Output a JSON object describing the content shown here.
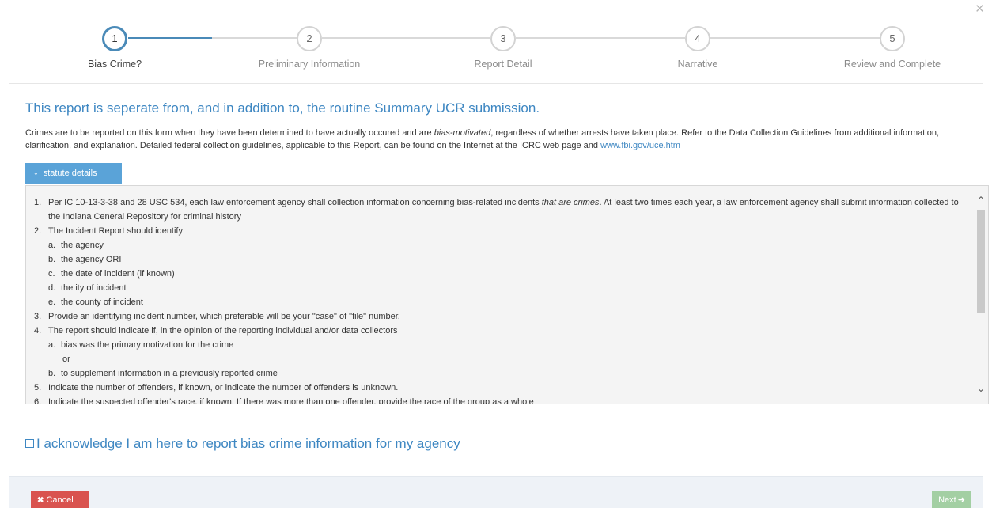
{
  "close_label": "×",
  "steps": [
    {
      "number": "1",
      "label": "Bias Crime?",
      "active": true
    },
    {
      "number": "2",
      "label": "Preliminary Information",
      "active": false
    },
    {
      "number": "3",
      "label": "Report Detail",
      "active": false
    },
    {
      "number": "4",
      "label": "Narrative",
      "active": false
    },
    {
      "number": "5",
      "label": "Review and Complete",
      "active": false
    }
  ],
  "headline": "This report is seperate from, and in addition to, the routine Summary UCR submission.",
  "intro": {
    "part1": "Crimes are to be reported on this form when they have been determined to have actually occured and are ",
    "emphasis": "bias-motivated",
    "part2": ", regardless of whether arrests have taken place.  Refer to the Data Collection Guidelines from additional information, clarification, and explanation.  Detailed federal collection guidelines, applicable to this Report, can be found on the Internet at the ICRC web page and ",
    "link": "www.fbi.gov/uce.htm"
  },
  "statute_button": {
    "icon": "chevron-down-icon",
    "label": "statute details"
  },
  "statute": {
    "item1": {
      "num": "1.",
      "part1": "Per IC 10-13-3-38 and 28 USC 534, each law enforcement agency shall collection information concerning bias-related incidents ",
      "emphasis": "that are crimes",
      "part2": ". At least two times each year, a law enforcement agency shall submit information collected to the Indiana Ceneral Repository for criminal history"
    },
    "item2": {
      "num": "2.",
      "text": "The Incident Report should identify"
    },
    "item2_subs": [
      {
        "num": "a.",
        "text": "the agency"
      },
      {
        "num": "b.",
        "text": "the agency ORI"
      },
      {
        "num": "c.",
        "text": "the date of incident (if known)"
      },
      {
        "num": "d.",
        "text": "the ity of incident"
      },
      {
        "num": "e.",
        "text": "the county of incident"
      }
    ],
    "item3": {
      "num": "3.",
      "text": "Provide an identifying incident number, which preferable will be your \"case\" of \"file\" number."
    },
    "item4": {
      "num": "4.",
      "text": "The report should indicate if, in the opinion of the reporting individual and/or data collectors"
    },
    "item4_sub_a": {
      "num": "a.",
      "text": "bias was the primary motivation for the crime"
    },
    "item4_or": "or",
    "item4_sub_b": {
      "num": "b.",
      "text": "to supplement information in a previously reported crime"
    },
    "item5": {
      "num": "5.",
      "text": "Indicate the number of offenders, if known, or indicate the number of offenders is unknown."
    },
    "item6": {
      "num": "6.",
      "text": "Indicate the suspected offender's race, if known. If there was more than one offender, provide the race of the group as a whole"
    }
  },
  "acknowledge_label": "I acknowledge I am here to report bias crime information for my agency",
  "footer": {
    "cancel_label": "Cancel",
    "cancel_icon": "x-icon",
    "next_label": "Next",
    "next_icon": "arrow-right-icon"
  },
  "colors": {
    "accent": "#3e87c2",
    "active_step": "#4a8ab8",
    "statute_button": "#5aa3d8",
    "cancel": "#d9534f",
    "next_disabled": "#a3cfa3"
  }
}
